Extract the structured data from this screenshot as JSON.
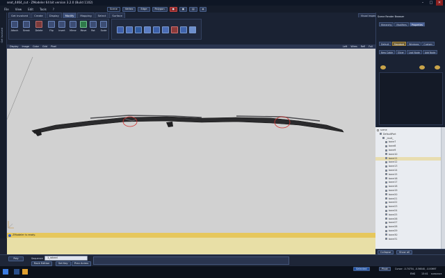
{
  "window": {
    "title": "seat_4464_cut - ZModeler 64 bit version 3.2.0 (Build 1102)",
    "min_glyph": "–",
    "max_glyph": "□",
    "close_glyph": "✕"
  },
  "menu": {
    "items": [
      "File",
      "View",
      "Edit",
      "Tools",
      "?"
    ],
    "selection_mode": "Scene",
    "toolbar_buttons": [
      "Vertex",
      "Edge",
      "Polygon"
    ]
  },
  "ribbon": {
    "tabs": [
      "Get Involved",
      "Create",
      "Display",
      "Modify",
      "Mapping",
      "Select",
      "Surface"
    ],
    "active_tab": "Modify",
    "left_label": "Get Involved",
    "buttons": [
      "Attach",
      "Break",
      "Delete",
      "Flip",
      "Insert",
      "Mirror",
      "Move",
      "Rot",
      "Scale"
    ],
    "right_tab": "Visual Inspector"
  },
  "viewport": {
    "menu": [
      "Display",
      "Image",
      "Color",
      "Grid",
      "Pixel"
    ],
    "view_name": "Left",
    "right_controls": [
      "Wires",
      "Refl",
      "Full"
    ]
  },
  "right_panel": {
    "header": "Scene Render Browser",
    "tabs": [
      "Hierarchy",
      "Modifiers",
      "Properties"
    ],
    "active_tab": "Properties",
    "row2": [
      "Default",
      "Standard",
      "Windows",
      "Custom"
    ],
    "row3": [
      "New Cable",
      "Slicer",
      "Last Node",
      "Add Node"
    ]
  },
  "tree": {
    "nodes": [
      {
        "label": "scene",
        "depth": 0,
        "checked": false,
        "hl": false
      },
      {
        "label": "DefaultPart",
        "depth": 1,
        "checked": true,
        "hl": false
      },
      {
        "label": "_mult_",
        "depth": 2,
        "checked": true,
        "hl": false
      },
      {
        "label": "bone7",
        "depth": 3,
        "checked": true,
        "hl": false
      },
      {
        "label": "bone8",
        "depth": 3,
        "checked": true,
        "hl": false
      },
      {
        "label": "bone9",
        "depth": 3,
        "checked": true,
        "hl": false
      },
      {
        "label": "bone10",
        "depth": 3,
        "checked": true,
        "hl": false
      },
      {
        "label": "bone11",
        "depth": 3,
        "checked": true,
        "hl": true
      },
      {
        "label": "bone12",
        "depth": 3,
        "checked": true,
        "hl": false
      },
      {
        "label": "bone13",
        "depth": 3,
        "checked": true,
        "hl": false
      },
      {
        "label": "bone14",
        "depth": 3,
        "checked": true,
        "hl": false
      },
      {
        "label": "bone15",
        "depth": 3,
        "checked": true,
        "hl": false
      },
      {
        "label": "bone16",
        "depth": 3,
        "checked": true,
        "hl": false
      },
      {
        "label": "bone17",
        "depth": 3,
        "checked": true,
        "hl": false
      },
      {
        "label": "bone18",
        "depth": 3,
        "checked": true,
        "hl": false
      },
      {
        "label": "bone19",
        "depth": 3,
        "checked": true,
        "hl": false
      },
      {
        "label": "bone20",
        "depth": 3,
        "checked": true,
        "hl": false
      },
      {
        "label": "bone21",
        "depth": 3,
        "checked": true,
        "hl": false
      },
      {
        "label": "bone22",
        "depth": 3,
        "checked": true,
        "hl": false
      },
      {
        "label": "bone23",
        "depth": 3,
        "checked": true,
        "hl": false
      },
      {
        "label": "bone24",
        "depth": 3,
        "checked": true,
        "hl": false
      },
      {
        "label": "bone25",
        "depth": 3,
        "checked": true,
        "hl": false
      },
      {
        "label": "bone26",
        "depth": 3,
        "checked": true,
        "hl": false
      },
      {
        "label": "bone27",
        "depth": 3,
        "checked": true,
        "hl": false
      },
      {
        "label": "bone28",
        "depth": 3,
        "checked": true,
        "hl": false
      },
      {
        "label": "bone29",
        "depth": 3,
        "checked": true,
        "hl": false
      },
      {
        "label": "bone30",
        "depth": 3,
        "checked": true,
        "hl": false
      },
      {
        "label": "bone31",
        "depth": 3,
        "checked": true,
        "hl": false
      }
    ],
    "footer": [
      "Collapse",
      "Show all"
    ]
  },
  "status": {
    "message": "ZModeler is ready."
  },
  "bottom": {
    "mode": "Poly",
    "sequence_label": "Sequence",
    "sequence_value": "1_wheel",
    "buttons": [
      "Rack Edition",
      "Set Key",
      "Prev Anims"
    ],
    "selected_label": "Selected",
    "axis_label": "Pivot",
    "cursor": "Cursor: -0.74754, -0.56040, -0.00697"
  },
  "taskbar": {
    "lang": "ENG",
    "time": "13:41",
    "date": "6/08/2023"
  },
  "colors": {
    "accent": "#3c4f78",
    "annotation": "#d2302d",
    "message": "#e6c75c"
  }
}
